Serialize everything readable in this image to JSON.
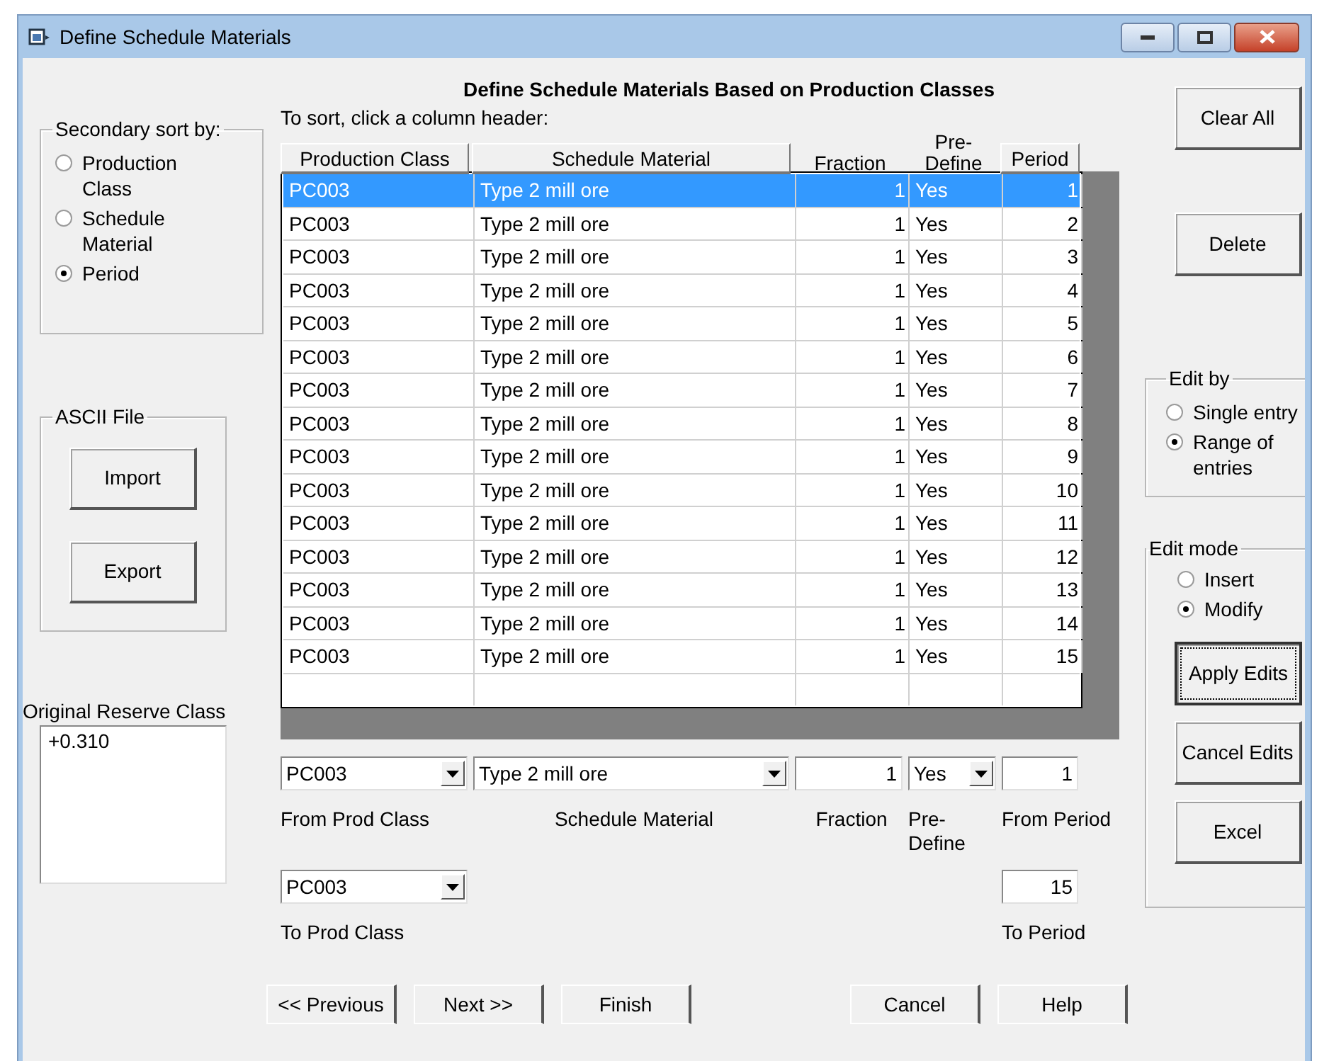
{
  "window": {
    "title": "Define Schedule Materials"
  },
  "heading": "Define Schedule Materials Based on Production Classes",
  "sort_group": {
    "label": "Secondary sort by:",
    "options": [
      {
        "label": "Production Class",
        "selected": false
      },
      {
        "label": "Schedule Material",
        "selected": false
      },
      {
        "label": "Period",
        "selected": true
      }
    ]
  },
  "ascii_group": {
    "label": "ASCII File",
    "buttons": [
      "Import",
      "Export"
    ]
  },
  "reserve": {
    "label": "Original Reserve Class",
    "items": [
      "+0.310"
    ]
  },
  "table": {
    "hint": "To sort, click a column header:",
    "columns": [
      {
        "label": "Production Class",
        "kind": "button"
      },
      {
        "label": "Schedule Material",
        "kind": "button"
      },
      {
        "label": "Fraction",
        "kind": "plain"
      },
      {
        "label": "Pre-Define",
        "kind": "plain"
      },
      {
        "label": "Period",
        "kind": "button"
      }
    ],
    "rows": [
      {
        "cells": [
          "PC003",
          "Type 2 mill ore",
          "1",
          "Yes",
          "1"
        ],
        "selected": true
      },
      {
        "cells": [
          "PC003",
          "Type 2 mill ore",
          "1",
          "Yes",
          "2"
        ],
        "selected": false
      },
      {
        "cells": [
          "PC003",
          "Type 2 mill ore",
          "1",
          "Yes",
          "3"
        ],
        "selected": false
      },
      {
        "cells": [
          "PC003",
          "Type 2 mill ore",
          "1",
          "Yes",
          "4"
        ],
        "selected": false
      },
      {
        "cells": [
          "PC003",
          "Type 2 mill ore",
          "1",
          "Yes",
          "5"
        ],
        "selected": false
      },
      {
        "cells": [
          "PC003",
          "Type 2 mill ore",
          "1",
          "Yes",
          "6"
        ],
        "selected": false
      },
      {
        "cells": [
          "PC003",
          "Type 2 mill ore",
          "1",
          "Yes",
          "7"
        ],
        "selected": false
      },
      {
        "cells": [
          "PC003",
          "Type 2 mill ore",
          "1",
          "Yes",
          "8"
        ],
        "selected": false
      },
      {
        "cells": [
          "PC003",
          "Type 2 mill ore",
          "1",
          "Yes",
          "9"
        ],
        "selected": false
      },
      {
        "cells": [
          "PC003",
          "Type 2 mill ore",
          "1",
          "Yes",
          "10"
        ],
        "selected": false
      },
      {
        "cells": [
          "PC003",
          "Type 2 mill ore",
          "1",
          "Yes",
          "11"
        ],
        "selected": false
      },
      {
        "cells": [
          "PC003",
          "Type 2 mill ore",
          "1",
          "Yes",
          "12"
        ],
        "selected": false
      },
      {
        "cells": [
          "PC003",
          "Type 2 mill ore",
          "1",
          "Yes",
          "13"
        ],
        "selected": false
      },
      {
        "cells": [
          "PC003",
          "Type 2 mill ore",
          "1",
          "Yes",
          "14"
        ],
        "selected": false
      },
      {
        "cells": [
          "PC003",
          "Type 2 mill ore",
          "1",
          "Yes",
          "15"
        ],
        "selected": false
      }
    ]
  },
  "editor": {
    "from_prod_class": {
      "value": "PC003",
      "label": "From Prod Class"
    },
    "schedule_material": {
      "value": "Type 2 mill ore",
      "label": "Schedule Material"
    },
    "fraction": {
      "value": "1",
      "label": "Fraction"
    },
    "pre_define": {
      "value": "Yes",
      "label": "Pre-Define"
    },
    "from_period": {
      "value": "1",
      "label": "From Period"
    },
    "to_prod_class": {
      "value": "PC003",
      "label": "To Prod Class"
    },
    "to_period": {
      "value": "15",
      "label": "To Period"
    }
  },
  "side_buttons": [
    "Clear All",
    "Delete"
  ],
  "edit_by": {
    "label": "Edit by",
    "options": [
      {
        "label": "Single entry",
        "selected": false
      },
      {
        "label": "Range of entries",
        "selected": true
      }
    ]
  },
  "edit_mode": {
    "label": "Edit mode",
    "options": [
      {
        "label": "Insert",
        "selected": false
      },
      {
        "label": "Modify",
        "selected": true
      }
    ],
    "buttons": [
      {
        "label": "Apply Edits",
        "focused": true
      },
      {
        "label": "Cancel Edits",
        "focused": false
      },
      {
        "label": "Excel",
        "focused": false
      }
    ]
  },
  "footer_buttons": [
    "<< Previous",
    "Next >>",
    "Finish",
    "Cancel",
    "Help"
  ]
}
